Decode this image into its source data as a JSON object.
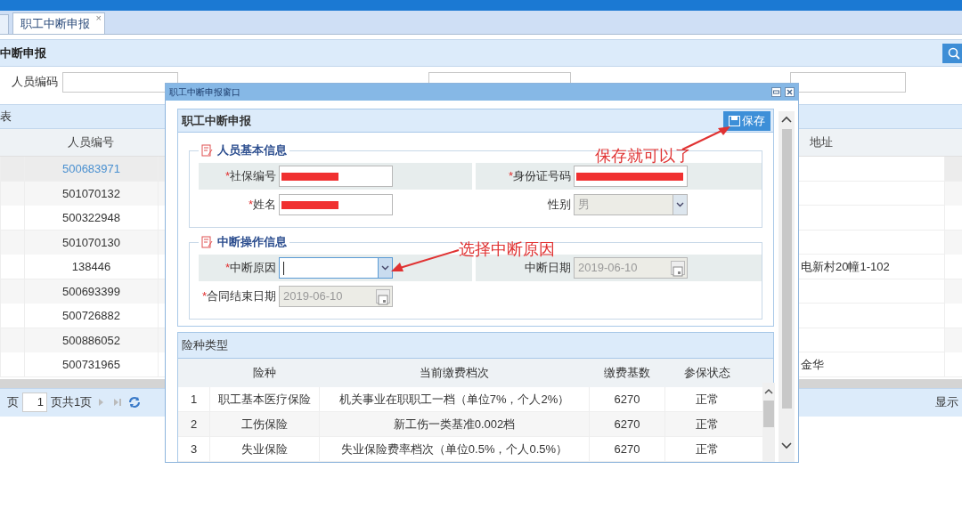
{
  "tabs": [
    {
      "label": "职工中断申报",
      "close": "×",
      "selected": true
    }
  ],
  "page_title": "中断申报",
  "search_fields": [
    {
      "label": "人员编码"
    }
  ],
  "list": {
    "title": "表",
    "columns": [
      "人员编号",
      "地址"
    ],
    "rows": [
      {
        "number": "500683971",
        "selected": true
      },
      {
        "number": "501070132",
        "selected": false
      },
      {
        "number": "500322948",
        "selected": false
      },
      {
        "number": "501070130",
        "selected": false
      },
      {
        "number": "138446",
        "address": "电新村20幢1-102",
        "selected": false
      },
      {
        "number": "500693399",
        "selected": false
      },
      {
        "number": "500726882",
        "selected": false
      },
      {
        "number": "500886052",
        "selected": false
      },
      {
        "number": "500731965",
        "address": "金华",
        "selected": false
      }
    ]
  },
  "pager": {
    "before": "页",
    "page": "1",
    "after": "页共1页",
    "summary": "显示"
  },
  "dialog": {
    "title": "职工中断申报窗口",
    "panel_title": "职工中断申报",
    "save_button": "保存",
    "sections": [
      {
        "title": "人员基本信息",
        "fields": [
          {
            "mark": "*",
            "label": "社保编号",
            "kind": "text",
            "redacted": true
          },
          {
            "mark": "*",
            "label": "身份证号码",
            "kind": "text",
            "redacted": true
          },
          {
            "mark": "*",
            "label": "姓名",
            "kind": "text",
            "redacted": true
          },
          {
            "label": "性别",
            "kind": "select",
            "value": "男",
            "disabled": true
          }
        ]
      },
      {
        "title": "中断操作信息",
        "fields": [
          {
            "mark": "*",
            "label": "中断原因",
            "kind": "select",
            "disabled": false,
            "focused": true
          },
          {
            "label": "中断日期",
            "kind": "date",
            "value": "2019-06-10",
            "disabled": true
          },
          {
            "mark": "*",
            "label": "合同结束日期",
            "kind": "date",
            "value": "2019-06-10",
            "disabled": true
          }
        ]
      }
    ],
    "insurance": {
      "title": "险种类型",
      "columns": [
        "险种",
        "当前缴费档次",
        "缴费基数",
        "参保状态"
      ],
      "rows": [
        {
          "index": "1",
          "type": "职工基本医疗保险",
          "grade": "机关事业在职职工一档（单位7%，个人2%）",
          "base": "6270",
          "status": "正常"
        },
        {
          "index": "2",
          "type": "工伤保险",
          "grade": "新工伤一类基准0.002档",
          "base": "6270",
          "status": "正常"
        },
        {
          "index": "3",
          "type": "失业保险",
          "grade": "失业保险费率档次（单位0.5%，个人0.5%）",
          "base": "6270",
          "status": "正常"
        }
      ]
    }
  },
  "annotations": [
    {
      "text": "保存就可以了"
    },
    {
      "text": "选择中断原因"
    }
  ]
}
